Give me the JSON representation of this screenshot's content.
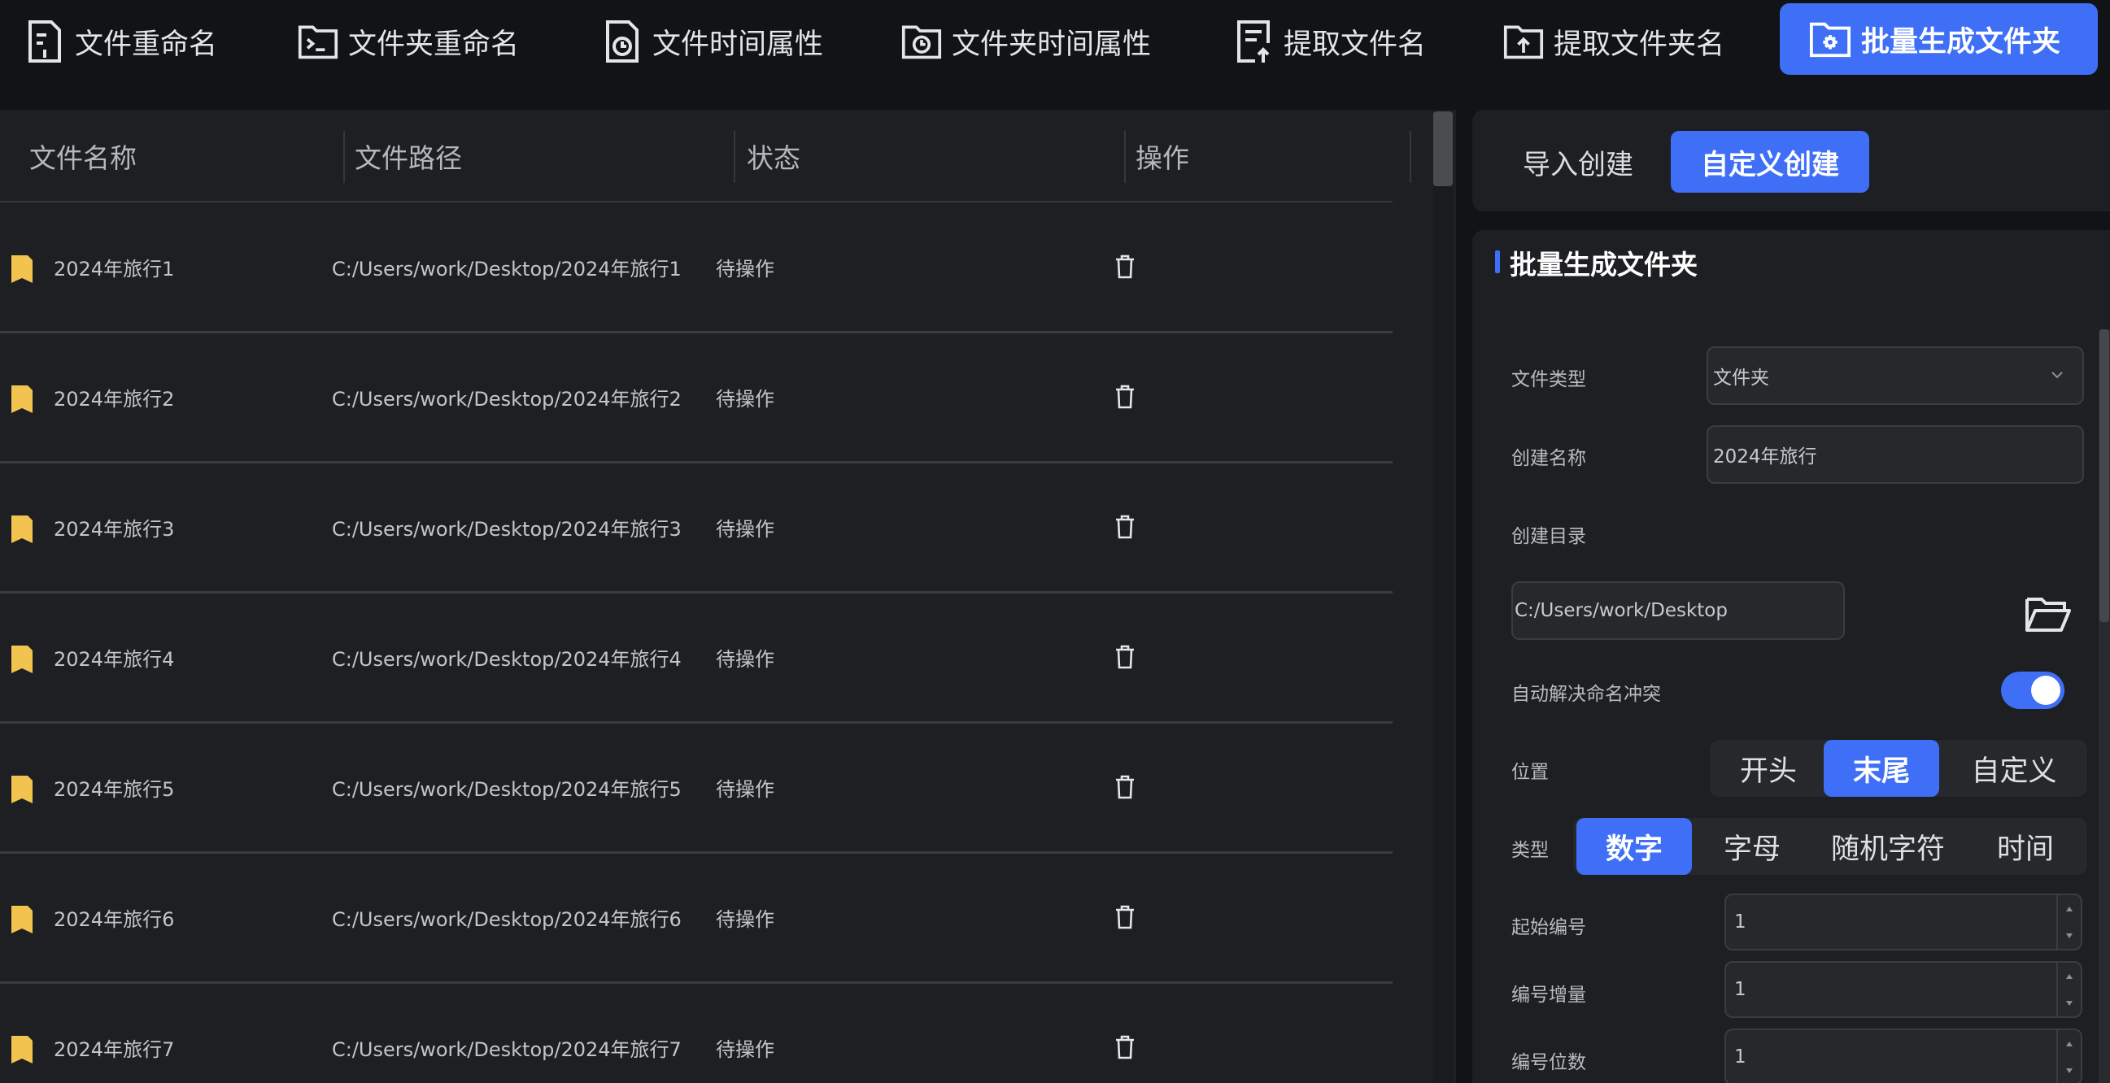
{
  "toolbar": {
    "items": [
      {
        "label": "文件重命名",
        "icon": "file-rename-icon"
      },
      {
        "label": "文件夹重命名",
        "icon": "folder-terminal-icon"
      },
      {
        "label": "文件时间属性",
        "icon": "file-clock-icon"
      },
      {
        "label": "文件夹时间属性",
        "icon": "folder-clock-icon"
      },
      {
        "label": "提取文件名",
        "icon": "file-extract-icon"
      },
      {
        "label": "提取文件夹名",
        "icon": "folder-upload-icon"
      },
      {
        "label": "批量生成文件夹",
        "icon": "folder-gear-icon",
        "active": true
      }
    ]
  },
  "table": {
    "columns": [
      "文件名称",
      "文件路径",
      "状态",
      "操作"
    ],
    "rows": [
      {
        "name": "2024年旅行1",
        "path": "C:/Users/work/Desktop/2024年旅行1",
        "status": "待操作"
      },
      {
        "name": "2024年旅行2",
        "path": "C:/Users/work/Desktop/2024年旅行2",
        "status": "待操作"
      },
      {
        "name": "2024年旅行3",
        "path": "C:/Users/work/Desktop/2024年旅行3",
        "status": "待操作"
      },
      {
        "name": "2024年旅行4",
        "path": "C:/Users/work/Desktop/2024年旅行4",
        "status": "待操作"
      },
      {
        "name": "2024年旅行5",
        "path": "C:/Users/work/Desktop/2024年旅行5",
        "status": "待操作"
      },
      {
        "name": "2024年旅行6",
        "path": "C:/Users/work/Desktop/2024年旅行6",
        "status": "待操作"
      },
      {
        "name": "2024年旅行7",
        "path": "C:/Users/work/Desktop/2024年旅行7",
        "status": "待操作"
      }
    ]
  },
  "panel": {
    "tabs": [
      "导入创建",
      "自定义创建"
    ],
    "active_tab": "自定义创建",
    "section_title": "批量生成文件夹",
    "file_type_label": "文件类型",
    "file_type_value": "文件夹",
    "create_name_label": "创建名称",
    "create_name_value": "2024年旅行",
    "create_dir_label": "创建目录",
    "create_dir_value": "C:/Users/work/Desktop",
    "auto_resolve_label": "自动解决命名冲突",
    "auto_resolve_on": true,
    "position_label": "位置",
    "position_options": [
      "开头",
      "末尾",
      "自定义"
    ],
    "position_selected": "末尾",
    "type_label": "类型",
    "type_options": [
      "数字",
      "字母",
      "随机字符",
      "时间"
    ],
    "type_selected": "数字",
    "start_number_label": "起始编号",
    "start_number_value": "1",
    "increment_label": "编号增量",
    "increment_value": "1",
    "digits_label": "编号位数",
    "digits_value": "1"
  },
  "colors": {
    "accent": "#3e6ff6",
    "folder": "#f2c34f",
    "background": "#121316",
    "panel": "#1e1f22"
  }
}
